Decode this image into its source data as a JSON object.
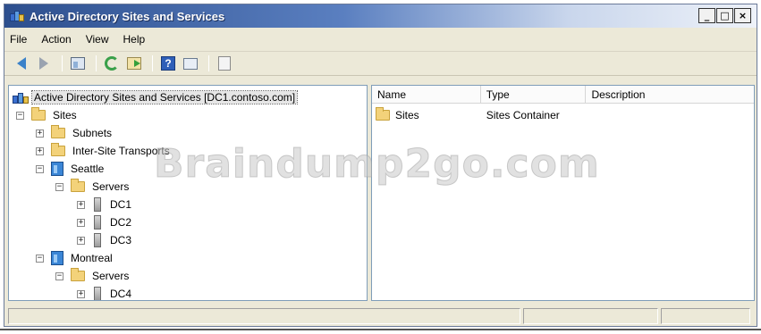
{
  "window": {
    "title": "Active Directory Sites and Services",
    "controls": {
      "minimize": "_",
      "maximize": "□",
      "close": "×"
    }
  },
  "menu": [
    {
      "label": "File"
    },
    {
      "label": "Action"
    },
    {
      "label": "View"
    },
    {
      "label": "Help"
    }
  ],
  "toolbar": {
    "icons": [
      "back-arrow-icon",
      "forward-arrow-icon",
      "show-hide-console-tree-icon",
      "refresh-icon",
      "export-list-icon",
      "help-icon",
      "properties-icon",
      "mmc-icon"
    ],
    "help_glyph": "?"
  },
  "tree": {
    "root": "Active Directory Sites and Services [DC1.contoso.com]",
    "sites": "Sites",
    "subnets": "Subnets",
    "inter_site_transports": "Inter-Site Transports",
    "seattle": "Seattle",
    "seattle_servers": "Servers",
    "dc1": "DC1",
    "dc2": "DC2",
    "dc3": "DC3",
    "montreal": "Montreal",
    "montreal_servers": "Servers",
    "dc4": "DC4",
    "expand_glyph": "+",
    "collapse_glyph": "−"
  },
  "list": {
    "columns": {
      "name": "Name",
      "type": "Type",
      "description": "Description"
    },
    "rows": [
      {
        "name": "Sites",
        "type": "Sites Container",
        "description": ""
      }
    ]
  },
  "watermark": "Braindump2go.com",
  "colors": {
    "title_gradient_start": "#2d4f8e",
    "pane_border": "#7f9db9",
    "chrome": "#ece9d8"
  }
}
